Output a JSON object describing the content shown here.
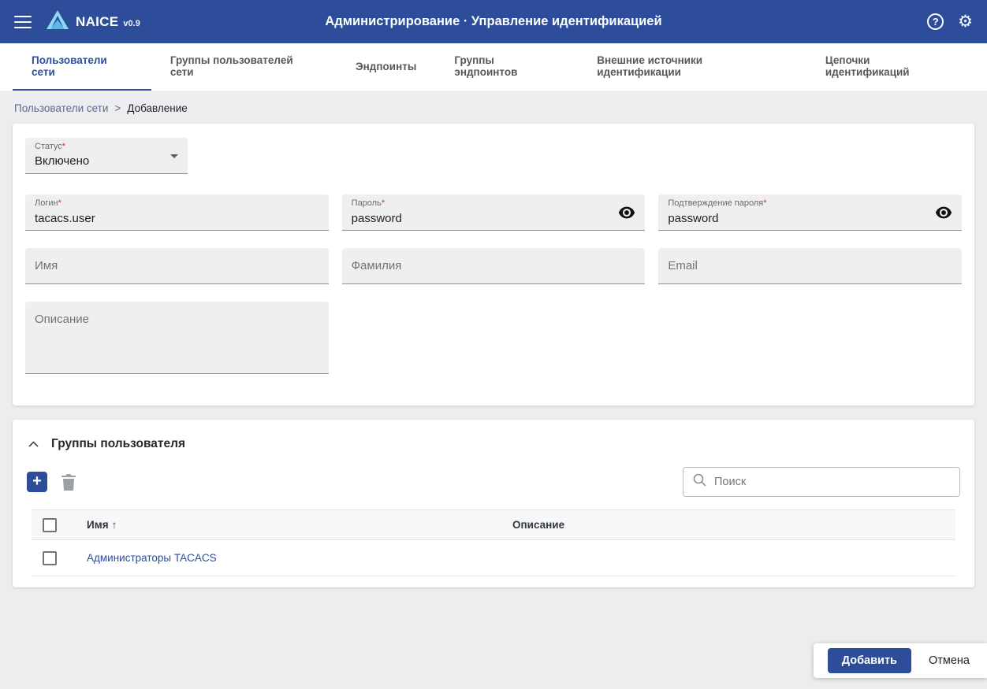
{
  "header": {
    "app_name": "NAICE",
    "app_version": "v0.9",
    "title": "Администрирование · Управление идентификацией"
  },
  "tabs": [
    {
      "label": "Пользователи сети"
    },
    {
      "label": "Группы пользователей сети"
    },
    {
      "label": "Эндпоинты"
    },
    {
      "label": "Группы эндпоинтов"
    },
    {
      "label": "Внешние источники идентификации"
    },
    {
      "label": "Цепочки идентификаций"
    }
  ],
  "breadcrumb": {
    "parent": "Пользователи сети",
    "separator": ">",
    "current": "Добавление"
  },
  "form": {
    "status": {
      "label": "Статус",
      "required_mark": "*",
      "value": "Включено"
    },
    "login": {
      "label": "Логин",
      "required_mark": "*",
      "value": "tacacs.user"
    },
    "password": {
      "label": "Пароль",
      "required_mark": "*",
      "value": "password"
    },
    "password_confirm": {
      "label": "Подтверждение пароля",
      "required_mark": "*",
      "value": "password"
    },
    "first_name": {
      "placeholder": "Имя"
    },
    "last_name": {
      "placeholder": "Фамилия"
    },
    "email": {
      "placeholder": "Email"
    },
    "description": {
      "placeholder": "Описание"
    }
  },
  "groups": {
    "title": "Группы пользователя",
    "search_placeholder": "Поиск",
    "table": {
      "col_name": "Имя",
      "sort_arrow": "↑",
      "col_description": "Описание",
      "rows": [
        {
          "name": "Администраторы TACACS",
          "description": ""
        }
      ]
    }
  },
  "footer": {
    "submit_label": "Добавить",
    "cancel_label": "Отмена"
  },
  "colors": {
    "primary": "#2d4d9b",
    "header_bg": "#2d4d9b",
    "required": "#d32f2f",
    "link": "#2d4d9b"
  }
}
